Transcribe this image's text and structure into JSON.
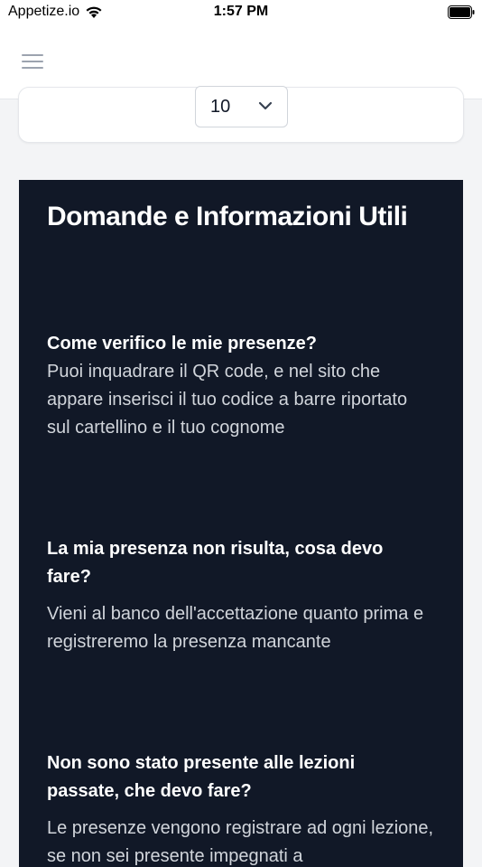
{
  "status_bar": {
    "carrier": "Appetize.io",
    "time": "1:57 PM"
  },
  "header": {
    "menu_icon": "hamburger-menu-icon"
  },
  "selector": {
    "value": "10",
    "icon": "chevron-down-icon"
  },
  "faq": {
    "title": "Domande e Informazioni Utili",
    "items": [
      {
        "question": "Come verifico le mie presenze?",
        "answer": "Puoi inquadrare il QR code, e nel sito che appare inserisci il tuo codice a barre riportato sul cartellino e il tuo cognome"
      },
      {
        "question": "La mia presenza non risulta, cosa devo fare?",
        "answer": "Vieni al banco dell'accettazione quanto prima e registreremo la presenza mancante"
      },
      {
        "question": "Non sono stato presente alle lezioni passate, che devo fare?",
        "answer": "Le presenze vengono registrare ad ogni lezione, se non sei presente impegnati a"
      }
    ]
  },
  "colors": {
    "panel_bg": "#111827",
    "page_bg": "#f3f4f6",
    "answer_text": "#d1d5db"
  }
}
